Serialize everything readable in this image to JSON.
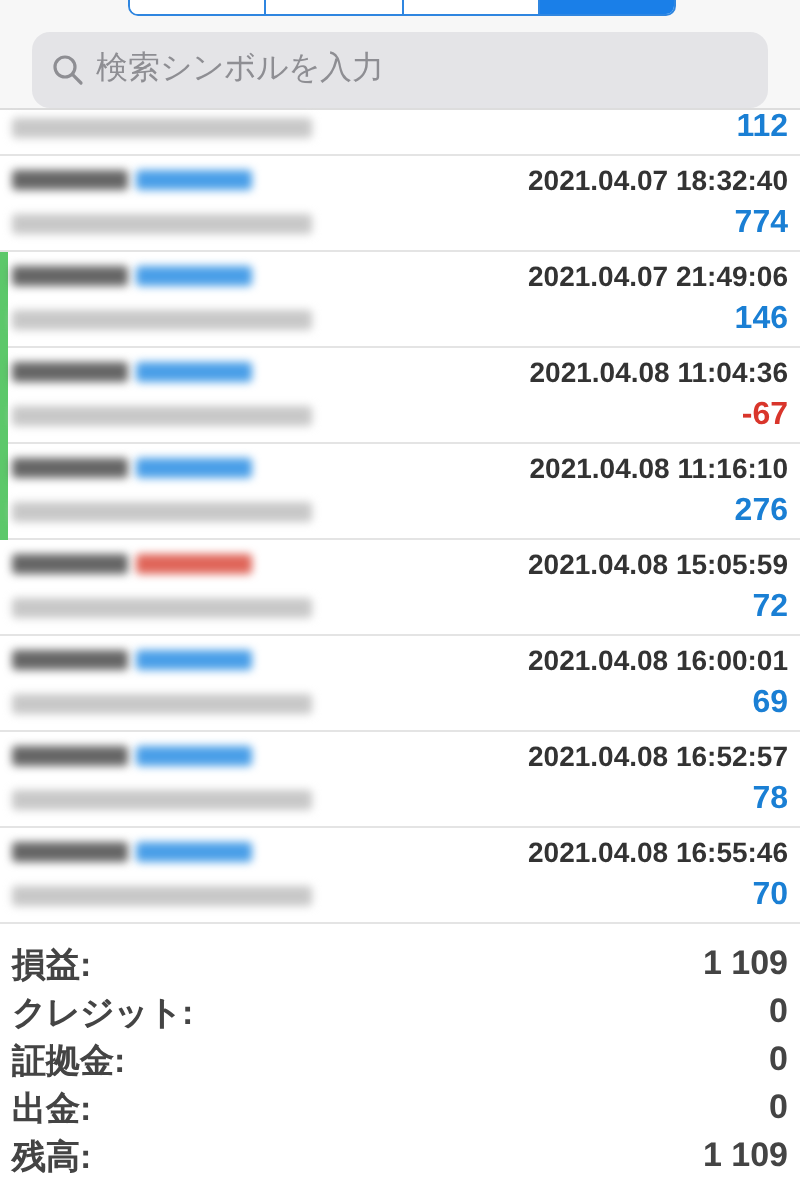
{
  "segments": [
    {
      "selected": false
    },
    {
      "selected": false
    },
    {
      "selected": false
    },
    {
      "selected": true
    }
  ],
  "search": {
    "placeholder": "検索シンボルを入力"
  },
  "partial_row": {
    "profit": "112",
    "negative": false
  },
  "deals": [
    {
      "time": "2021.04.07 18:32:40",
      "profit": "774",
      "negative": false,
      "marked": false,
      "color": "#4a9fe8"
    },
    {
      "time": "2021.04.07 21:49:06",
      "profit": "146",
      "negative": false,
      "marked": true,
      "color": "#4a9fe8"
    },
    {
      "time": "2021.04.08 11:04:36",
      "profit": "-67",
      "negative": true,
      "marked": true,
      "color": "#4a9fe8"
    },
    {
      "time": "2021.04.08 11:16:10",
      "profit": "276",
      "negative": false,
      "marked": true,
      "color": "#4a9fe8"
    },
    {
      "time": "2021.04.08 15:05:59",
      "profit": "72",
      "negative": false,
      "marked": false,
      "color": "#e0665a"
    },
    {
      "time": "2021.04.08 16:00:01",
      "profit": "69",
      "negative": false,
      "marked": false,
      "color": "#4a9fe8"
    },
    {
      "time": "2021.04.08 16:52:57",
      "profit": "78",
      "negative": false,
      "marked": false,
      "color": "#4a9fe8"
    },
    {
      "time": "2021.04.08 16:55:46",
      "profit": "70",
      "negative": false,
      "marked": false,
      "color": "#4a9fe8"
    }
  ],
  "summary": [
    {
      "label": "損益:",
      "value": "1 109"
    },
    {
      "label": "クレジット:",
      "value": "0"
    },
    {
      "label": "証拠金:",
      "value": "0"
    },
    {
      "label": "出金:",
      "value": "0"
    },
    {
      "label": "残高:",
      "value": "1 109"
    }
  ]
}
